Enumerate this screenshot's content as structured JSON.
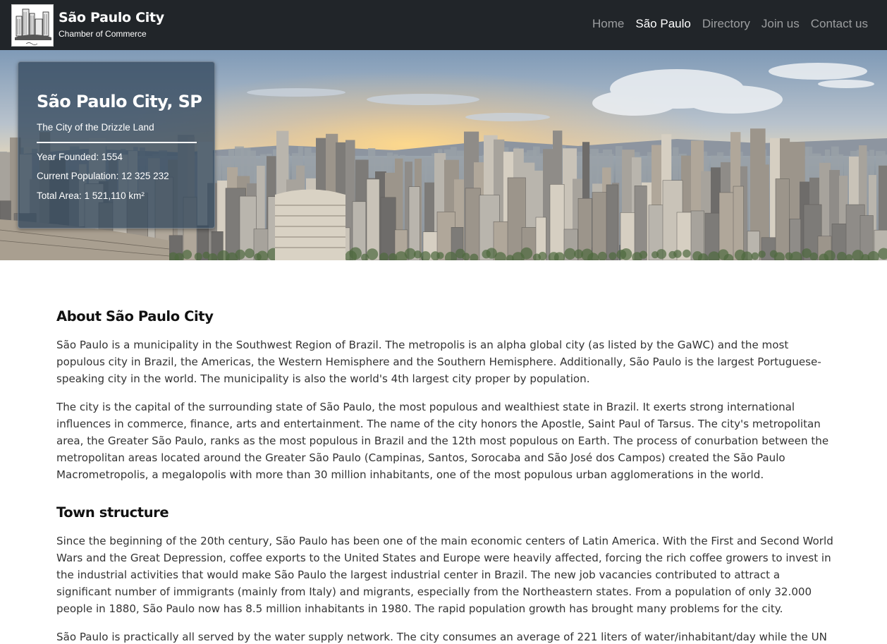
{
  "brand": {
    "title": "São Paulo City",
    "subtitle": "Chamber of Commerce"
  },
  "nav": {
    "items": [
      "Home",
      "São Paulo",
      "Directory",
      "Join us",
      "Contact us"
    ],
    "active_index": 1
  },
  "hero": {
    "card_title": "São Paulo City, SP",
    "card_subtitle": "The City of the Drizzle Land",
    "facts": [
      "Year Founded: 1554",
      "Current Population: 12 325 232",
      "Total Area: 1 521,110 km²"
    ]
  },
  "about": {
    "heading": "About São Paulo City",
    "paragraphs": [
      "São Paulo is a municipality in the Southwest Region of Brazil. The metropolis is an alpha global city (as listed by the GaWC) and the most populous city in Brazil, the Americas, the Western Hemisphere and the Southern Hemisphere. Additionally, São Paulo is the largest Portuguese-speaking city in the world. The municipality is also the world's 4th largest city proper by population.",
      "The city is the capital of the surrounding state of São Paulo, the most populous and wealthiest state in Brazil. It exerts strong international influences in commerce, finance, arts and entertainment. The name of the city honors the Apostle, Saint Paul of Tarsus. The city's metropolitan area, the Greater São Paulo, ranks as the most populous in Brazil and the 12th most populous on Earth. The process of conurbation between the metropolitan areas located around the Greater São Paulo (Campinas, Santos, Sorocaba and São José dos Campos) created the São Paulo Macrometropolis, a megalopolis with more than 30 million inhabitants, one of the most populous urban agglomerations in the world."
    ]
  },
  "town_structure": {
    "heading": "Town structure",
    "paragraphs": [
      "Since the beginning of the 20th century, São Paulo has been one of the main economic centers of Latin America. With the First and Second World Wars and the Great Depression, coffee exports to the United States and Europe were heavily affected, forcing the rich coffee growers to invest in the industrial activities that would make São Paulo the largest industrial center in Brazil. The new job vacancies contributed to attract a significant number of immigrants (mainly from Italy) and migrants, especially from the Northeastern states. From a population of only 32.000 people in 1880, São Paulo now has 8.5 million inhabitants in 1980. The rapid population growth has brought many problems for the city.",
      "São Paulo is practically all served by the water supply network. The city consumes an average of 221 liters of water/inhabitant/day while the UN"
    ]
  },
  "colors": {
    "navbar_bg": "#212529",
    "nav_active": "#ffffff",
    "nav_inactive": "rgba(255,255,255,0.55)",
    "card_bg": "rgba(52,73,94,0.78)"
  }
}
